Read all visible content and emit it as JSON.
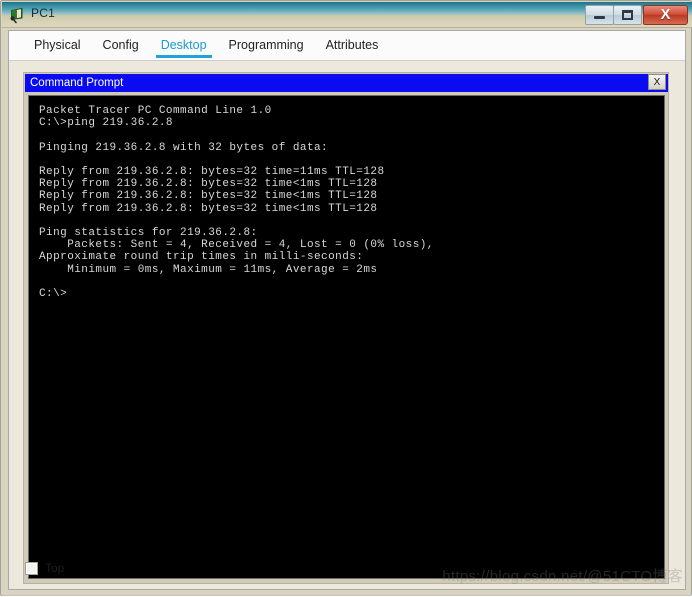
{
  "window": {
    "title": "PC1",
    "icon": "pc-device-icon",
    "buttons": {
      "minimize": "minimize-icon",
      "maximize": "maximize-icon",
      "close": "X"
    }
  },
  "tabs": [
    {
      "label": "Physical",
      "active": false
    },
    {
      "label": "Config",
      "active": false
    },
    {
      "label": "Desktop",
      "active": true
    },
    {
      "label": "Programming",
      "active": false
    },
    {
      "label": "Attributes",
      "active": false
    }
  ],
  "command_prompt": {
    "title": "Command Prompt",
    "close_label": "X",
    "lines": [
      "Packet Tracer PC Command Line 1.0",
      "C:\\>ping 219.36.2.8",
      "",
      "Pinging 219.36.2.8 with 32 bytes of data:",
      "",
      "Reply from 219.36.2.8: bytes=32 time=11ms TTL=128",
      "Reply from 219.36.2.8: bytes=32 time<1ms TTL=128",
      "Reply from 219.36.2.8: bytes=32 time<1ms TTL=128",
      "Reply from 219.36.2.8: bytes=32 time<1ms TTL=128",
      "",
      "Ping statistics for 219.36.2.8:",
      "    Packets: Sent = 4, Received = 4, Lost = 0 (0% loss),",
      "Approximate round trip times in milli-seconds:",
      "    Minimum = 0ms, Maximum = 11ms, Average = 2ms",
      "",
      "C:\\>"
    ]
  },
  "bottom": {
    "top_checkbox_label": "Top",
    "top_checked": false
  },
  "watermark": "https://blog.csdn.net/@51CTO博客",
  "colors": {
    "tab_active": "#1a9ad1",
    "cmd_titlebar": "#0b0bf2",
    "terminal_bg": "#000000",
    "terminal_fg": "#d8d8d8",
    "pane_bg": "#ece9dc"
  }
}
